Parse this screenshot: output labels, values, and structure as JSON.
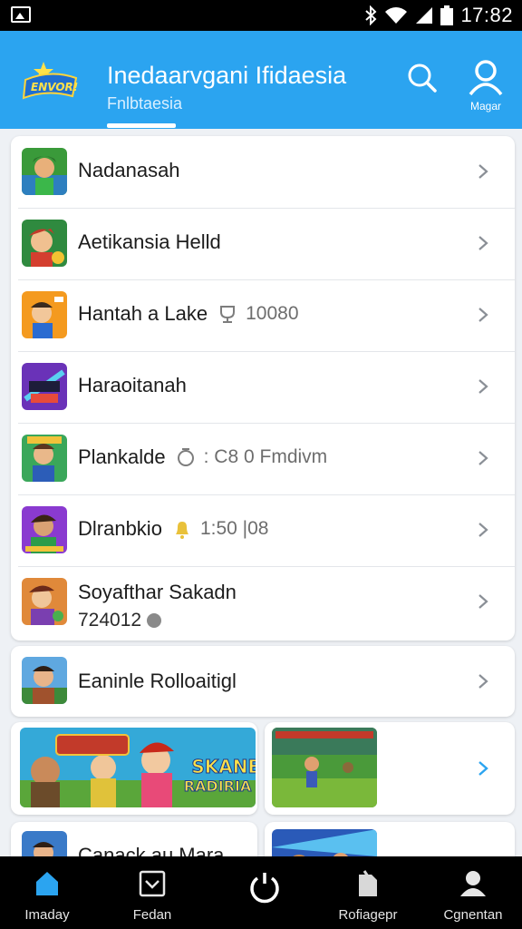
{
  "status_bar": {
    "time": "17:82"
  },
  "header": {
    "title": "Inedaarvgani Ifidaesia",
    "subtitle": "Fnlbtaesia",
    "logo_text": "ENVOR!",
    "profile_label": "Magar"
  },
  "list": [
    {
      "title": "Nadanasah",
      "meta": "",
      "sub": ""
    },
    {
      "title": "Aetikansia Helld",
      "meta": "",
      "sub": ""
    },
    {
      "title": "Hantah a Lake",
      "meta": "10080",
      "sub": ""
    },
    {
      "title": "Haraoitanah",
      "meta": "",
      "sub": ""
    },
    {
      "title": "Plankalde",
      "meta": ": C8 0 Fmdivm",
      "sub": ""
    },
    {
      "title": "Dlranbkio",
      "meta": "1:50 |08",
      "sub": ""
    },
    {
      "title": "Soyafthar Sakadn",
      "meta": "",
      "sub": "724012"
    }
  ],
  "single_item": {
    "title": "Eaninle Rolloaitigl"
  },
  "promo": {
    "badge_line1": "SKANB",
    "badge_line2": "RADIRIA"
  },
  "peek_item": {
    "title": "Canack au Mara"
  },
  "bottom_nav": [
    {
      "label": "Imaday"
    },
    {
      "label": "Fedan"
    },
    {
      "label": ""
    },
    {
      "label": "Rofiagepr"
    },
    {
      "label": "Cgnentan"
    }
  ],
  "colors": {
    "accent": "#2ba4f0",
    "nav_active": "#2ba4f0",
    "nav_bg": "#000000"
  }
}
